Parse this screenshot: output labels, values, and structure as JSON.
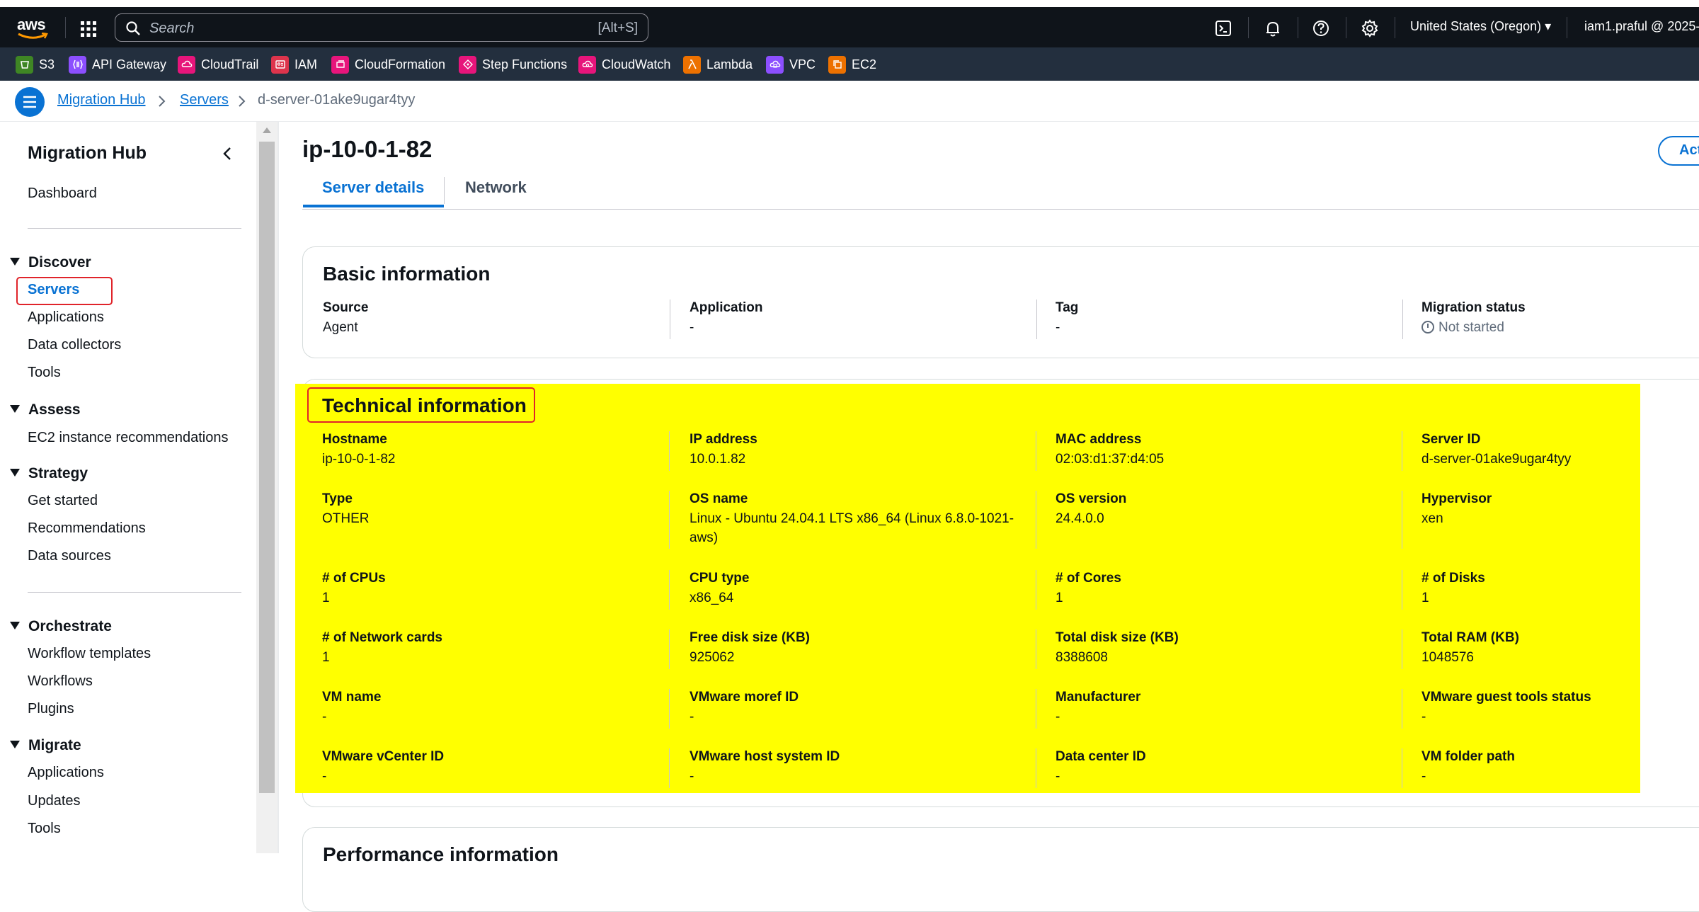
{
  "topnav": {
    "logo_text": "aws",
    "search_placeholder": "Search",
    "search_shortcut": "[Alt+S]",
    "region": "United States (Oregon) ▾",
    "user": "iam1.praful @ 2025-"
  },
  "favorites": [
    {
      "label": "S3",
      "color": "#3f8624"
    },
    {
      "label": "API Gateway",
      "color": "#8c4fff"
    },
    {
      "label": "CloudTrail",
      "color": "#e7157b"
    },
    {
      "label": "IAM",
      "color": "#dd344c"
    },
    {
      "label": "CloudFormation",
      "color": "#e7157b"
    },
    {
      "label": "Step Functions",
      "color": "#e7157b"
    },
    {
      "label": "CloudWatch",
      "color": "#e7157b"
    },
    {
      "label": "Lambda",
      "color": "#ed7100"
    },
    {
      "label": "VPC",
      "color": "#8c4fff"
    },
    {
      "label": "EC2",
      "color": "#ed7100"
    }
  ],
  "breadcrumb": {
    "items": [
      "Migration Hub",
      "Servers"
    ],
    "current": "d-server-01ake9ugar4tyy"
  },
  "sidebar": {
    "title": "Migration Hub",
    "dashboard": "Dashboard",
    "sections": [
      {
        "title": "Discover",
        "items": [
          "Servers",
          "Applications",
          "Data collectors",
          "Tools"
        ]
      },
      {
        "title": "Assess",
        "items": [
          "EC2 instance recommendations"
        ]
      },
      {
        "title": "Strategy",
        "items": [
          "Get started",
          "Recommendations",
          "Data sources"
        ]
      },
      {
        "title": "Orchestrate",
        "items": [
          "Workflow templates",
          "Workflows",
          "Plugins"
        ]
      },
      {
        "title": "Migrate",
        "items": [
          "Applications",
          "Updates",
          "Tools"
        ]
      }
    ]
  },
  "page": {
    "title": "ip-10-0-1-82",
    "action_label": "Act",
    "tabs": [
      "Server details",
      "Network"
    ]
  },
  "basic": {
    "title": "Basic information",
    "fields": [
      {
        "k": "Source",
        "v": "Agent"
      },
      {
        "k": "Application",
        "v": "-"
      },
      {
        "k": "Tag",
        "v": "-"
      },
      {
        "k": "Migration status",
        "v": "Not started"
      }
    ]
  },
  "technical": {
    "title": "Technical information",
    "rows": [
      [
        {
          "k": "Hostname",
          "v": "ip-10-0-1-82"
        },
        {
          "k": "IP address",
          "v": "10.0.1.82"
        },
        {
          "k": "MAC address",
          "v": "02:03:d1:37:d4:05"
        },
        {
          "k": "Server ID",
          "v": "d-server-01ake9ugar4tyy"
        }
      ],
      [
        {
          "k": "Type",
          "v": "OTHER"
        },
        {
          "k": "OS name",
          "v": "Linux - Ubuntu 24.04.1 LTS x86_64 (Linux 6.8.0-1021-aws)"
        },
        {
          "k": "OS version",
          "v": "24.4.0.0"
        },
        {
          "k": "Hypervisor",
          "v": "xen"
        }
      ],
      [
        {
          "k": "# of CPUs",
          "v": "1"
        },
        {
          "k": "CPU type",
          "v": "x86_64"
        },
        {
          "k": "# of Cores",
          "v": "1"
        },
        {
          "k": "# of Disks",
          "v": "1"
        }
      ],
      [
        {
          "k": "# of Network cards",
          "v": "1"
        },
        {
          "k": "Free disk size (KB)",
          "v": "925062"
        },
        {
          "k": "Total disk size (KB)",
          "v": "8388608"
        },
        {
          "k": "Total RAM (KB)",
          "v": "1048576"
        }
      ],
      [
        {
          "k": "VM name",
          "v": "-"
        },
        {
          "k": "VMware moref ID",
          "v": "-"
        },
        {
          "k": "Manufacturer",
          "v": "-"
        },
        {
          "k": "VMware guest tools status",
          "v": "-"
        }
      ],
      [
        {
          "k": "VMware vCenter ID",
          "v": "-"
        },
        {
          "k": "VMware host system ID",
          "v": "-"
        },
        {
          "k": "Data center ID",
          "v": "-"
        },
        {
          "k": "VM folder path",
          "v": "-"
        }
      ]
    ]
  },
  "performance": {
    "title": "Performance information"
  }
}
